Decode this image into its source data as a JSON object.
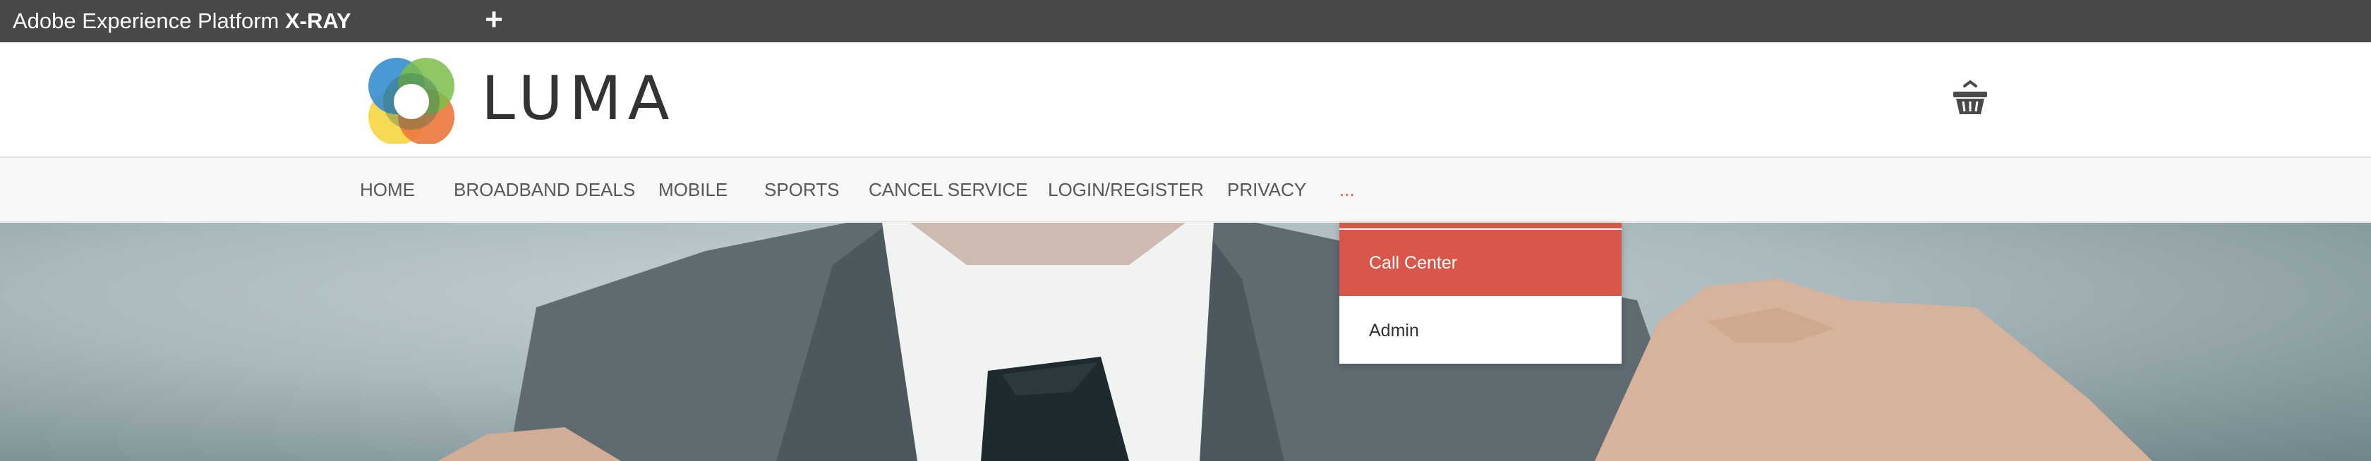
{
  "xray": {
    "title_prefix": "Adobe Experience Platform ",
    "title_strong": "X-RAY",
    "add_symbol": "+"
  },
  "header": {
    "brand": "LUMA",
    "logo_icon": "luma-rings-logo-icon",
    "cart_icon": "shopping-basket-icon"
  },
  "nav": {
    "items": [
      {
        "label": "HOME"
      },
      {
        "label": "BROADBAND DEALS"
      },
      {
        "label": "MOBILE"
      },
      {
        "label": "SPORTS"
      },
      {
        "label": "CANCEL SERVICE"
      },
      {
        "label": "LOGIN/REGISTER"
      },
      {
        "label": "PRIVACY"
      }
    ],
    "more_label": "..."
  },
  "dropdown": {
    "items": [
      {
        "label": "Call Center",
        "active": true
      },
      {
        "label": "Admin",
        "active": false
      }
    ]
  },
  "colors": {
    "xray_bar": "#474948",
    "accent": "#d9574a",
    "nav_bg": "#f8f8f7",
    "text": "#575757"
  }
}
